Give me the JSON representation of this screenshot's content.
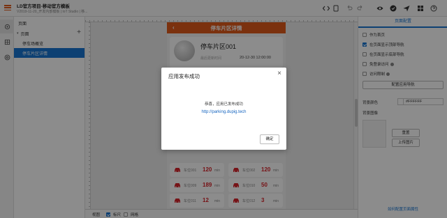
{
  "topbar": {
    "title": "LD官方项目-移动官方模板",
    "subtitle": "V2019-11-20_开发内部模板 | IoT Studio | 移..."
  },
  "pages_panel": {
    "header": "页面",
    "root_label": "页面",
    "items": [
      {
        "label": "停车场概览"
      },
      {
        "label": "停车片区详情"
      }
    ]
  },
  "phone": {
    "header_title": "停车片区详情",
    "back_glyph": "‹",
    "lot": {
      "name": "停车片区001",
      "note": "最后更新时间",
      "time": "20-12-30 12:00:00"
    },
    "slots": [
      {
        "label": "车位001",
        "value": "120",
        "unit": "min"
      },
      {
        "label": "车位002",
        "value": "120",
        "unit": "min"
      },
      {
        "label": "车位009",
        "value": "189",
        "unit": "min"
      },
      {
        "label": "车位010",
        "value": "50",
        "unit": "min"
      },
      {
        "label": "车位011",
        "value": "12",
        "unit": "min"
      },
      {
        "label": "车位012",
        "value": "3",
        "unit": "min"
      }
    ]
  },
  "props": {
    "tab": "页面配置",
    "options": [
      {
        "label": "作为首页",
        "checked": false,
        "help": false
      },
      {
        "label": "在页面显示顶部导航",
        "checked": true,
        "help": false
      },
      {
        "label": "在页面显示底部导航",
        "checked": false,
        "help": false
      },
      {
        "label": "免登录访问",
        "checked": false,
        "help": true
      },
      {
        "label": "访问限制",
        "checked": false,
        "help": true
      }
    ],
    "config_nav_button": "配置应用导航",
    "bg_color_label": "背景颜色",
    "bg_color_value": "#FFFFFF",
    "bg_image_label": "背景图像",
    "reset_button": "重置",
    "upload_button": "上传图片",
    "help_link": "如何配置页面属性"
  },
  "statusbar": {
    "view_label": "视图",
    "ruler_label": "标尺",
    "ruler_checked": true,
    "grid_label": "网格",
    "grid_checked": false
  },
  "modal": {
    "title": "应用发布成功",
    "close_glyph": "×",
    "message": "恭喜，应用已发布成功",
    "url": "http://parking.dupig.tech",
    "ok_button": "确定"
  },
  "colors": {
    "accent": "#e05a1b",
    "primary": "#1976d2",
    "danger": "#d8232a"
  }
}
